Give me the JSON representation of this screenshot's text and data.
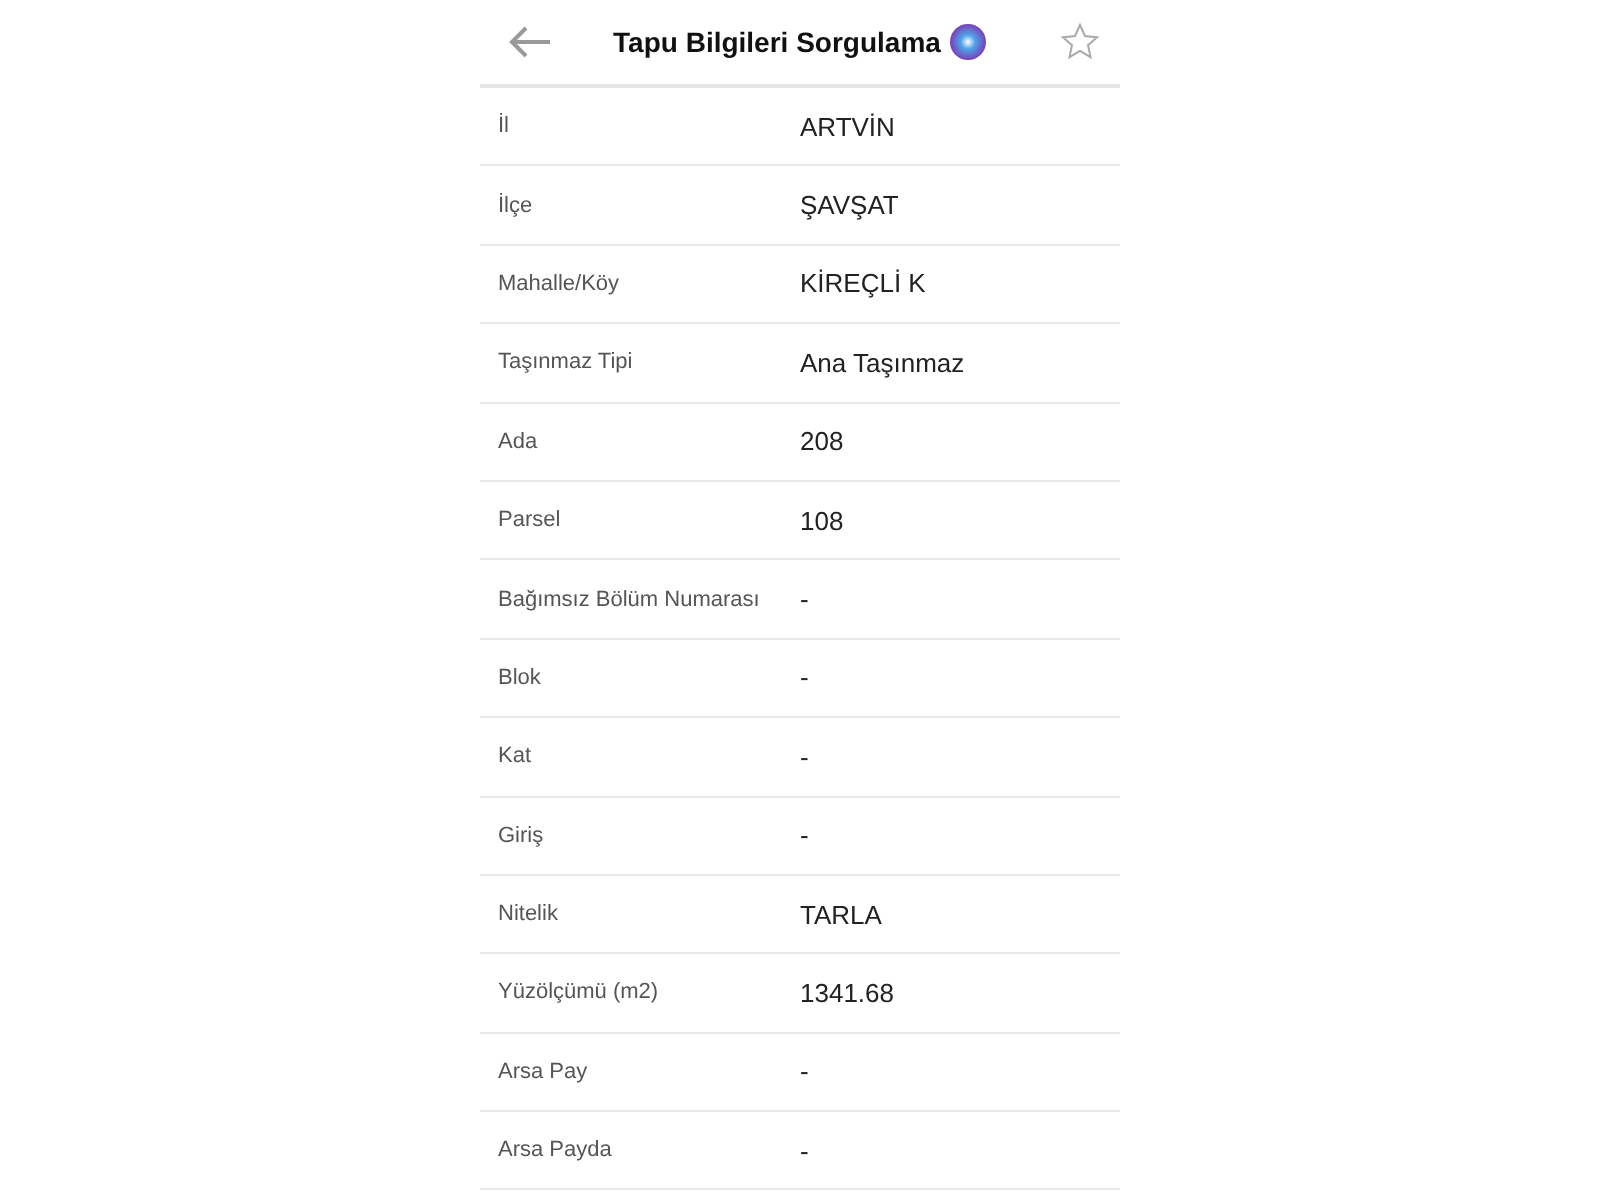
{
  "header": {
    "title": "Tapu Bilgileri Sorgulama"
  },
  "rows": [
    {
      "label": "İl",
      "value": "ARTVİN"
    },
    {
      "label": "İlçe",
      "value": "ŞAVŞAT"
    },
    {
      "label": "Mahalle/Köy",
      "value": "KİREÇLİ K"
    },
    {
      "label": "Taşınmaz Tipi",
      "value": "Ana Taşınmaz"
    },
    {
      "label": "Ada",
      "value": "208"
    },
    {
      "label": "Parsel",
      "value": "108"
    },
    {
      "label": "Bağımsız Bölüm Numarası",
      "value": "-"
    },
    {
      "label": "Blok",
      "value": "-"
    },
    {
      "label": "Kat",
      "value": "-"
    },
    {
      "label": "Giriş",
      "value": "-"
    },
    {
      "label": "Nitelik",
      "value": "TARLA"
    },
    {
      "label": "Yüzölçümü (m2)",
      "value": "1341.68"
    },
    {
      "label": "Arsa Pay",
      "value": "-"
    },
    {
      "label": "Arsa Payda",
      "value": "-"
    }
  ]
}
